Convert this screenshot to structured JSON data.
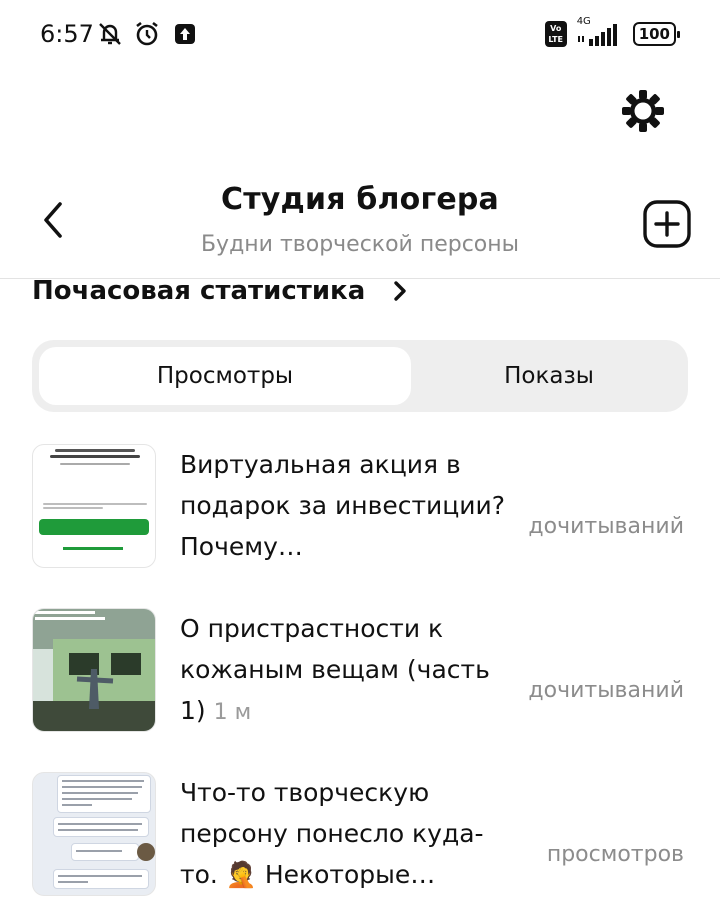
{
  "status_bar": {
    "time": "6:57",
    "network": "4G",
    "battery": "100",
    "lte_badge": "Vo LTE"
  },
  "header": {
    "title": "Студия блогера",
    "subtitle": "Будни творческой персоны"
  },
  "section": {
    "title": "Почасовая статистика"
  },
  "tabs": [
    {
      "label": "Просмотры",
      "active": true
    },
    {
      "label": "Показы",
      "active": false
    }
  ],
  "items": [
    {
      "title": "Виртуальная акция в подарок за инвестиции? Почему…",
      "meta": "",
      "stat_label": "дочитываний"
    },
    {
      "title": "О пристрастности к кожаным вещам (часть 1)",
      "meta": "1 м",
      "stat_label": "дочитываний"
    },
    {
      "title": "Что-то творческую персону понесло куда-то. 🤦 Некоторые…",
      "meta": "",
      "stat_label": "просмотров"
    }
  ],
  "colors": {
    "accent_green": "#1f9b3a",
    "muted_text": "#8a8a8a",
    "segment_bg": "#eeeeee"
  }
}
